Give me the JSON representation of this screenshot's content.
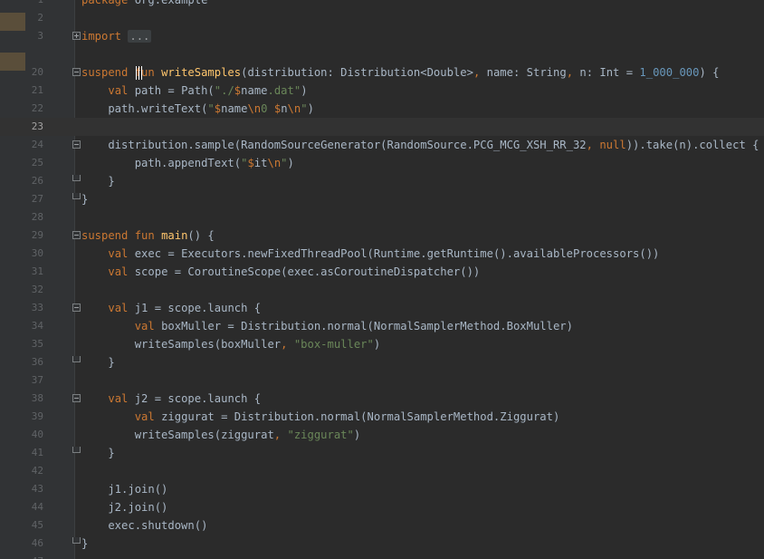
{
  "editor": {
    "language": "kotlin",
    "current_line": "23",
    "lines": [
      {
        "number": "1",
        "tokens": [
          [
            "kw",
            "package"
          ],
          [
            "dim",
            " org.example"
          ]
        ]
      },
      {
        "number": "2",
        "tokens": []
      },
      {
        "number": "3",
        "tokens": [
          [
            "kw",
            "import"
          ],
          [
            "dim",
            " "
          ],
          [
            "fold",
            "..."
          ]
        ]
      },
      {
        "number": "",
        "tokens": []
      },
      {
        "number": "20",
        "tokens": [
          [
            "kw",
            "suspend fun "
          ],
          [
            "fn",
            "writeSamples"
          ],
          [
            "dim",
            "(distribution: Distribution<Double>"
          ],
          [
            "kw",
            ", "
          ],
          [
            "dim",
            "name: String"
          ],
          [
            "kw",
            ", "
          ],
          [
            "dim",
            "n: Int = "
          ],
          [
            "num",
            "1_000_000"
          ],
          [
            "dim",
            ") {"
          ]
        ]
      },
      {
        "number": "21",
        "tokens": [
          [
            "dim",
            "    "
          ],
          [
            "kw",
            "val "
          ],
          [
            "dim",
            "path = Path("
          ],
          [
            "str",
            "\"./"
          ],
          [
            "esc",
            "$"
          ],
          [
            "dim",
            "name"
          ],
          [
            "str",
            ".dat\""
          ],
          [
            "dim",
            ")"
          ]
        ]
      },
      {
        "number": "22",
        "tokens": [
          [
            "dim",
            "    path.writeText("
          ],
          [
            "str",
            "\""
          ],
          [
            "esc",
            "$"
          ],
          [
            "dim",
            "name"
          ],
          [
            "esc",
            "\\n"
          ],
          [
            "str",
            "0 "
          ],
          [
            "esc",
            "$"
          ],
          [
            "dim",
            "n"
          ],
          [
            "esc",
            "\\n"
          ],
          [
            "str",
            "\""
          ],
          [
            "dim",
            ")"
          ]
        ]
      },
      {
        "number": "23",
        "tokens": []
      },
      {
        "number": "24",
        "tokens": [
          [
            "dim",
            "    distribution.sample(RandomSourceGenerator(RandomSource.PCG_MCG_XSH_RR_32"
          ],
          [
            "kw",
            ", "
          ],
          [
            "kw",
            "null"
          ],
          [
            "dim",
            ")).take(n).collect {"
          ]
        ]
      },
      {
        "number": "25",
        "tokens": [
          [
            "dim",
            "        path.appendText("
          ],
          [
            "str",
            "\""
          ],
          [
            "esc",
            "$"
          ],
          [
            "dim",
            "it"
          ],
          [
            "esc",
            "\\n"
          ],
          [
            "str",
            "\""
          ],
          [
            "dim",
            ")"
          ]
        ]
      },
      {
        "number": "26",
        "tokens": [
          [
            "dim",
            "    }"
          ]
        ]
      },
      {
        "number": "27",
        "tokens": [
          [
            "dim",
            "}"
          ]
        ]
      },
      {
        "number": "28",
        "tokens": []
      },
      {
        "number": "29",
        "tokens": [
          [
            "kw",
            "suspend fun "
          ],
          [
            "fn",
            "main"
          ],
          [
            "dim",
            "() {"
          ]
        ]
      },
      {
        "number": "30",
        "tokens": [
          [
            "dim",
            "    "
          ],
          [
            "kw",
            "val "
          ],
          [
            "dim",
            "exec = Executors.newFixedThreadPool(Runtime.getRuntime().availableProcessors())"
          ]
        ]
      },
      {
        "number": "31",
        "tokens": [
          [
            "dim",
            "    "
          ],
          [
            "kw",
            "val "
          ],
          [
            "dim",
            "scope = CoroutineScope(exec.asCoroutineDispatcher())"
          ]
        ]
      },
      {
        "number": "32",
        "tokens": []
      },
      {
        "number": "33",
        "tokens": [
          [
            "dim",
            "    "
          ],
          [
            "kw",
            "val "
          ],
          [
            "dim",
            "j1 = scope.launch {"
          ]
        ]
      },
      {
        "number": "34",
        "tokens": [
          [
            "dim",
            "        "
          ],
          [
            "kw",
            "val "
          ],
          [
            "dim",
            "boxMuller = Distribution.normal(NormalSamplerMethod.BoxMuller)"
          ]
        ]
      },
      {
        "number": "35",
        "tokens": [
          [
            "dim",
            "        writeSamples(boxMuller"
          ],
          [
            "kw",
            ", "
          ],
          [
            "str",
            "\"box-muller\""
          ],
          [
            "dim",
            ")"
          ]
        ]
      },
      {
        "number": "36",
        "tokens": [
          [
            "dim",
            "    }"
          ]
        ]
      },
      {
        "number": "37",
        "tokens": []
      },
      {
        "number": "38",
        "tokens": [
          [
            "dim",
            "    "
          ],
          [
            "kw",
            "val "
          ],
          [
            "dim",
            "j2 = scope.launch {"
          ]
        ]
      },
      {
        "number": "39",
        "tokens": [
          [
            "dim",
            "        "
          ],
          [
            "kw",
            "val "
          ],
          [
            "dim",
            "ziggurat = Distribution.normal(NormalSamplerMethod.Ziggurat)"
          ]
        ]
      },
      {
        "number": "40",
        "tokens": [
          [
            "dim",
            "        writeSamples(ziggurat"
          ],
          [
            "kw",
            ", "
          ],
          [
            "str",
            "\"ziggurat\""
          ],
          [
            "dim",
            ")"
          ]
        ]
      },
      {
        "number": "41",
        "tokens": [
          [
            "dim",
            "    }"
          ]
        ]
      },
      {
        "number": "42",
        "tokens": []
      },
      {
        "number": "43",
        "tokens": [
          [
            "dim",
            "    j1.join()"
          ]
        ]
      },
      {
        "number": "44",
        "tokens": [
          [
            "dim",
            "    j2.join()"
          ]
        ]
      },
      {
        "number": "45",
        "tokens": [
          [
            "dim",
            "    exec.shutdown()"
          ]
        ]
      },
      {
        "number": "46",
        "tokens": [
          [
            "dim",
            "}"
          ]
        ]
      },
      {
        "number": "47",
        "tokens": []
      }
    ],
    "folds": {
      "3": "plus",
      "20": "minus",
      "24": "minus",
      "26": "end",
      "27": "end",
      "29": "minus",
      "33": "minus",
      "36": "end",
      "38": "minus",
      "41": "end",
      "46": "end"
    }
  }
}
